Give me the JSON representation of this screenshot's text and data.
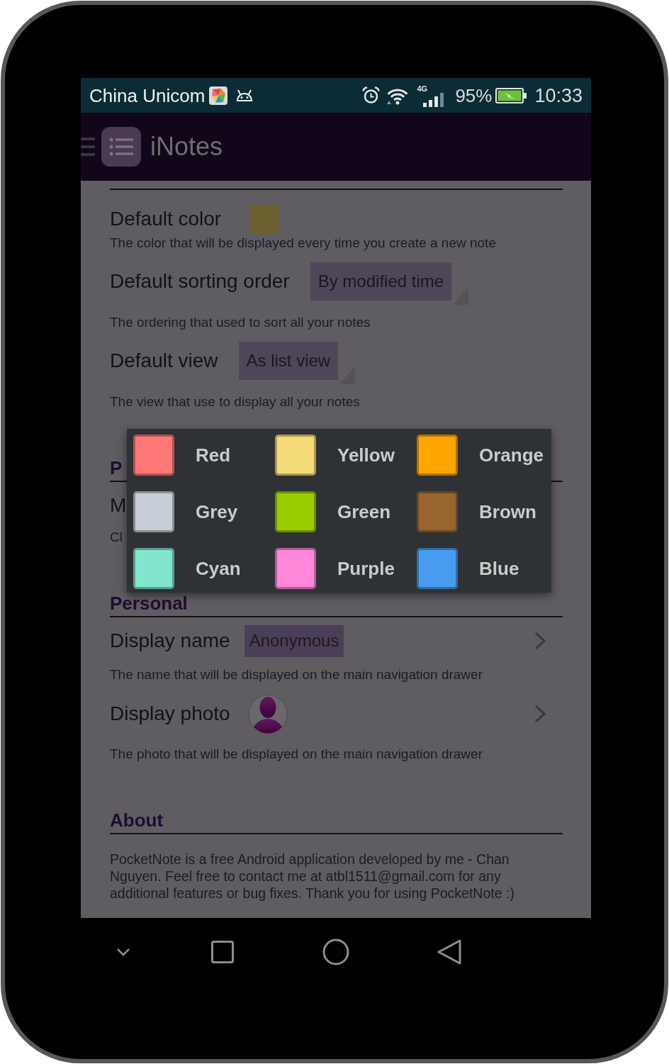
{
  "status_bar": {
    "carrier": "China Unicom",
    "network": "4G",
    "battery": "95%",
    "time": "10:33"
  },
  "app_bar": {
    "title": "iNotes"
  },
  "sections": [
    {
      "items": [
        {
          "kind": "color",
          "title": "Default color",
          "color": "#6d602f",
          "description": "The color that will be displayed every time you create a new note"
        },
        {
          "kind": "dropdown",
          "title": "Default sorting order",
          "value": "By modified time",
          "description": "The ordering that used to sort all your notes"
        },
        {
          "kind": "dropdown",
          "title": "Default view",
          "value": "As list view",
          "description": "The view that use to display all your notes"
        }
      ]
    },
    {
      "title": "P",
      "items": [
        {
          "kind": "plain",
          "title": "M",
          "description": "Cl"
        }
      ]
    },
    {
      "title": "Personal",
      "items": [
        {
          "kind": "text",
          "title": "Display name",
          "value": "Anonymous",
          "description": "The name that will be displayed on the main navigation drawer"
        },
        {
          "kind": "photo",
          "title": "Display photo",
          "description": "The photo that will be displayed on the main navigation drawer"
        }
      ]
    },
    {
      "title": "About",
      "text": "PocketNote is a free Android application developed by me - Chan Nguyen. Feel free to contact me at atbl1511@gmail.com for any additional features or bug fixes. Thank you for using PocketNote :)"
    }
  ],
  "color_menu": {
    "options": [
      {
        "label": "Red",
        "color": "#fe7877"
      },
      {
        "label": "Yellow",
        "color": "#f5dc78"
      },
      {
        "label": "Orange",
        "color": "#ffa500"
      },
      {
        "label": "Grey",
        "color": "#c8ced8"
      },
      {
        "label": "Green",
        "color": "#9acd00"
      },
      {
        "label": "Brown",
        "color": "#98652f"
      },
      {
        "label": "Cyan",
        "color": "#82e5cd"
      },
      {
        "label": "Purple",
        "color": "#ff88d8"
      },
      {
        "label": "Blue",
        "color": "#489cf0"
      }
    ]
  }
}
